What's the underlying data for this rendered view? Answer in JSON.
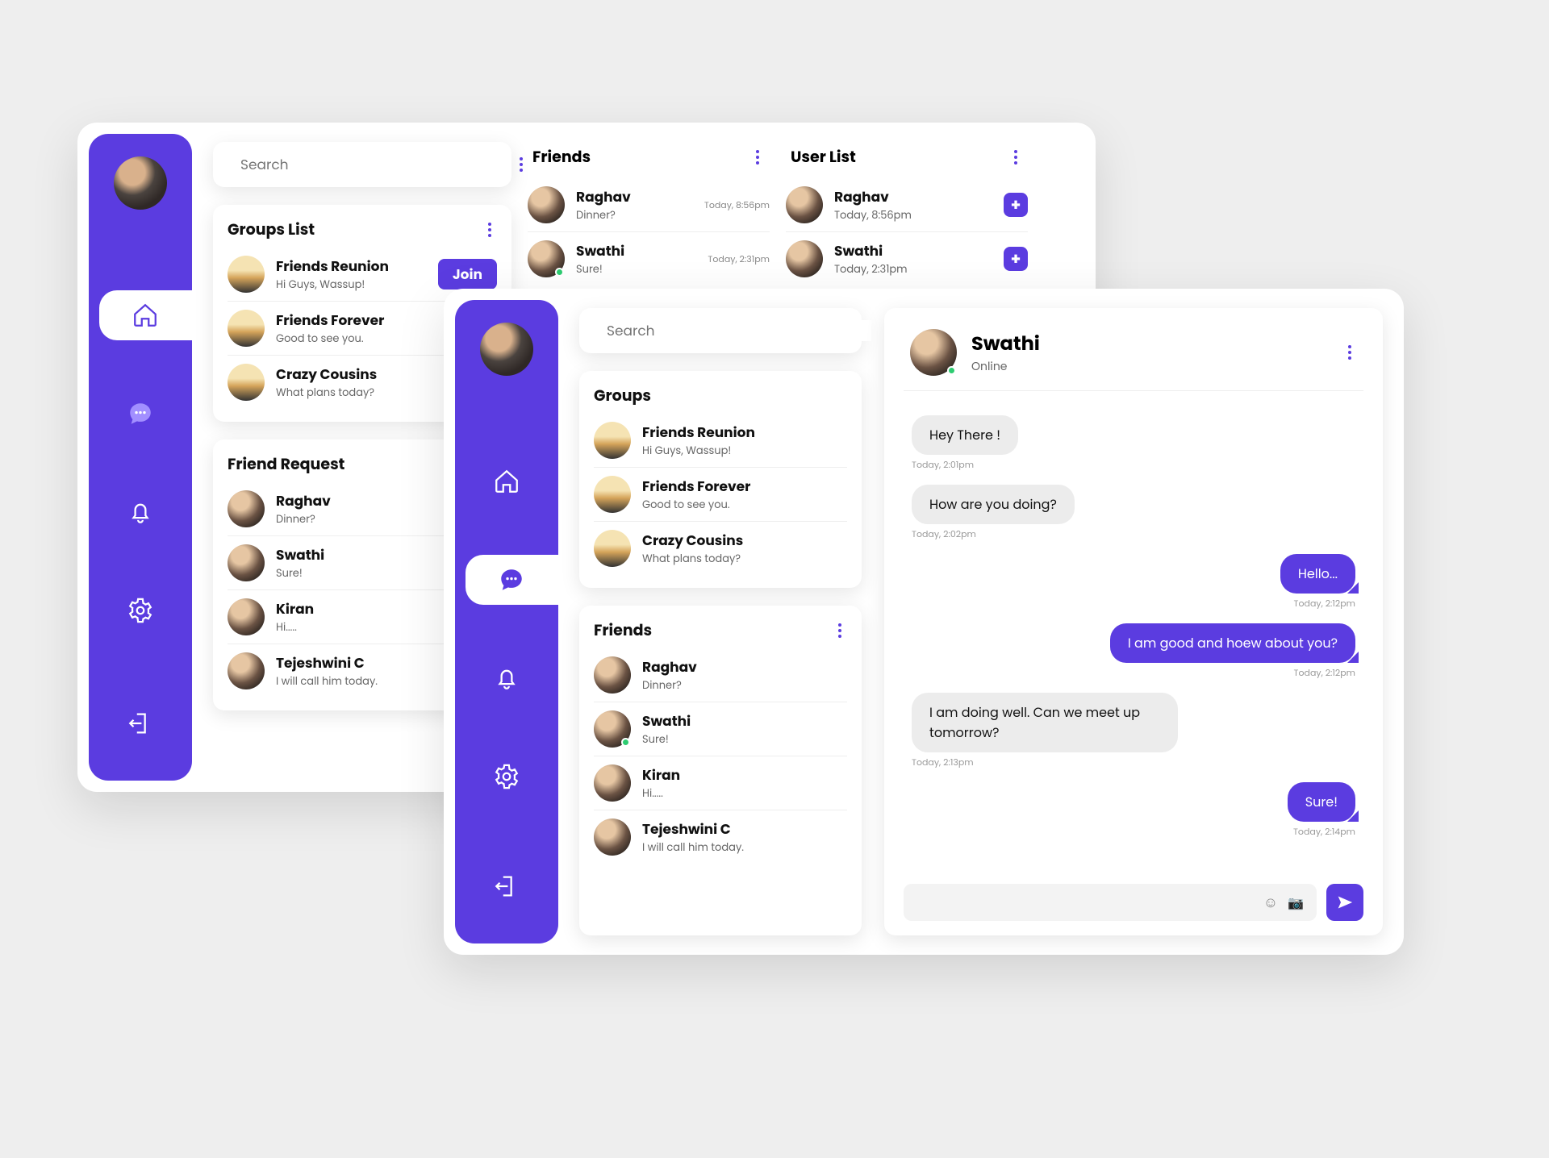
{
  "search_placeholder": "Search",
  "join_label": "Join",
  "back": {
    "sections": {
      "groups_title": "Groups List",
      "groups": [
        {
          "name": "Friends Reunion",
          "sub": "Hi Guys, Wassup!",
          "join": true
        },
        {
          "name": "Friends Forever",
          "sub": "Good to see you."
        },
        {
          "name": "Crazy Cousins",
          "sub": "What plans today?"
        }
      ],
      "req_title": "Friend  Request",
      "requests": [
        {
          "name": "Raghav",
          "sub": "Dinner?"
        },
        {
          "name": "Swathi",
          "sub": "Sure!"
        },
        {
          "name": "Kiran",
          "sub": "Hi....."
        },
        {
          "name": "Tejeshwini C",
          "sub": "I will call him today."
        }
      ],
      "friends_title": "Friends",
      "friends": [
        {
          "name": "Raghav",
          "sub": "Dinner?",
          "time": "Today, 8:56pm"
        },
        {
          "name": "Swathi",
          "sub": "Sure!",
          "time": "Today, 2:31pm",
          "online": true
        }
      ],
      "userlist_title": "User List",
      "users": [
        {
          "name": "Raghav",
          "time": "Today, 8:56pm"
        },
        {
          "name": "Swathi",
          "time": "Today, 2:31pm"
        }
      ]
    }
  },
  "front": {
    "groups_title": "Groups",
    "groups": [
      {
        "name": "Friends Reunion",
        "sub": "Hi Guys, Wassup!"
      },
      {
        "name": "Friends Forever",
        "sub": "Good to see you."
      },
      {
        "name": "Crazy Cousins",
        "sub": "What plans today?"
      }
    ],
    "friends_title": "Friends",
    "friends": [
      {
        "name": "Raghav",
        "sub": "Dinner?"
      },
      {
        "name": "Swathi",
        "sub": "Sure!",
        "online": true
      },
      {
        "name": "Kiran",
        "sub": "Hi....."
      },
      {
        "name": "Tejeshwini C",
        "sub": "I will call him today."
      }
    ],
    "chat": {
      "name": "Swathi",
      "status": "Online",
      "messages": [
        {
          "dir": "in",
          "text": "Hey There !",
          "time": "Today, 2:01pm"
        },
        {
          "dir": "in",
          "text": "How are you doing?",
          "time": "Today, 2:02pm"
        },
        {
          "dir": "out",
          "text": "Hello...",
          "time": "Today, 2:12pm"
        },
        {
          "dir": "out",
          "text": "I am good  and hoew about you?",
          "time": "Today, 2:12pm"
        },
        {
          "dir": "in",
          "text": "I am doing well. Can we meet up tomorrow?",
          "time": "Today, 2:13pm"
        },
        {
          "dir": "out",
          "text": "Sure!",
          "time": "Today, 2:14pm"
        }
      ]
    }
  }
}
